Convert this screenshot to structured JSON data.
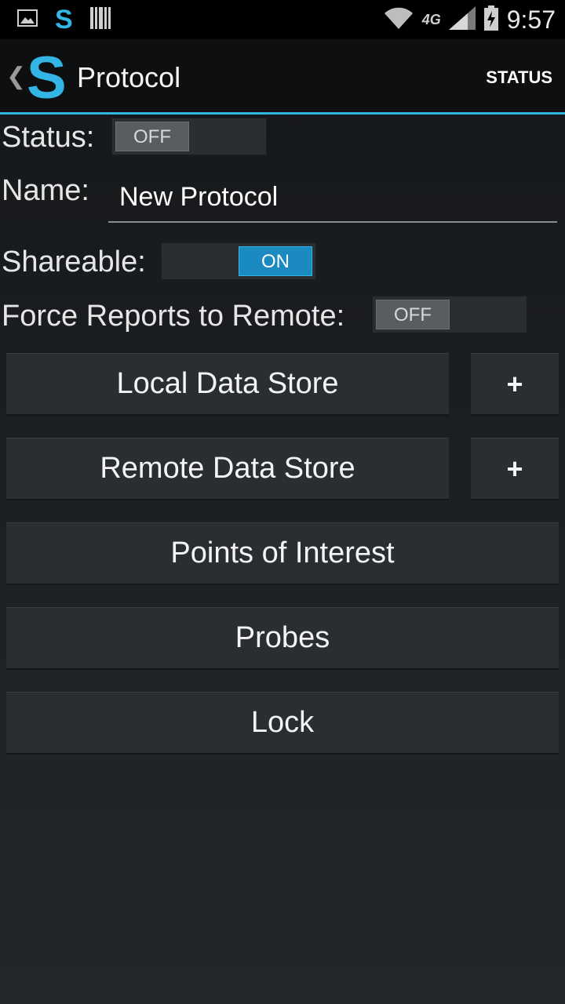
{
  "status_bar": {
    "left_icons": [
      "image-notification-icon",
      "app-s-notification-icon",
      "barcode-notification-icon"
    ],
    "app_letter": "S",
    "network_label": "4G",
    "right_icons": [
      "wifi-icon",
      "cell-signal-icon",
      "battery-charging-icon"
    ],
    "time": "9:57"
  },
  "action_bar": {
    "logo_letter": "S",
    "title": "Protocol",
    "action_label": "STATUS",
    "accent_color": "#33b5e5"
  },
  "form": {
    "status_label": "Status:",
    "status_toggle": "OFF",
    "name_label": "Name:",
    "name_value": "New Protocol",
    "shareable_label": "Shareable:",
    "shareable_toggle": "ON",
    "force_label": "Force Reports to Remote:",
    "force_toggle": "OFF"
  },
  "buttons": {
    "local_data_store": "Local Data Store",
    "local_add": "+",
    "remote_data_store": "Remote Data Store",
    "remote_add": "+",
    "points_of_interest": "Points of Interest",
    "probes": "Probes",
    "lock": "Lock"
  }
}
